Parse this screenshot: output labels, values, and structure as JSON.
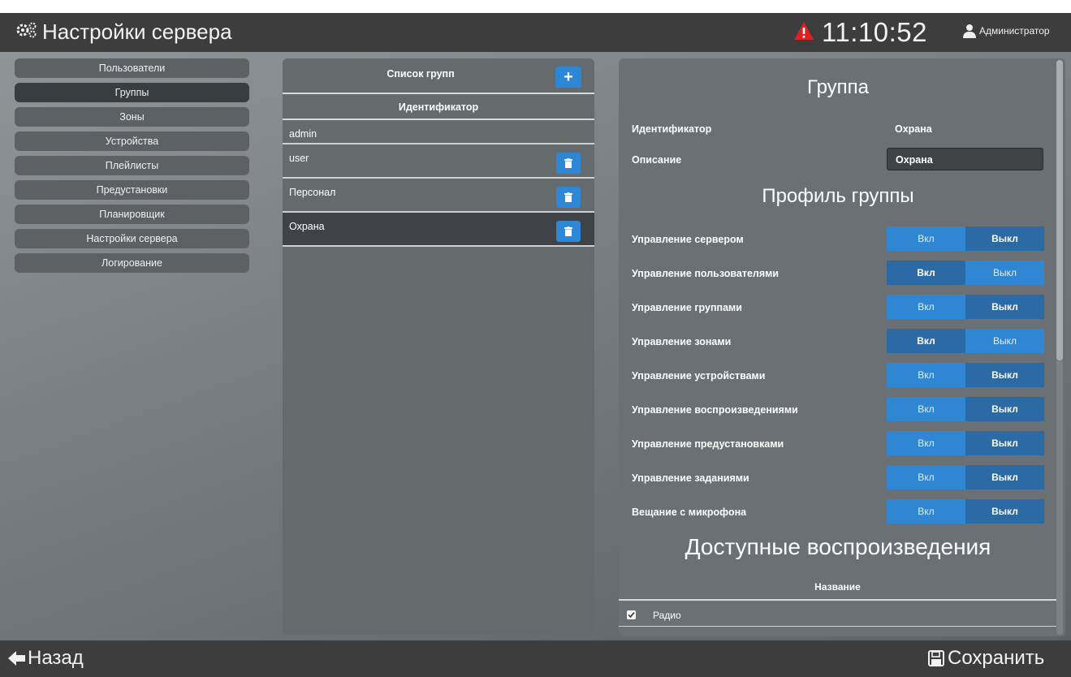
{
  "header": {
    "title": "Настройки сервера",
    "time": "11:10:52",
    "user": "Администратор"
  },
  "sidebar": {
    "items": [
      {
        "label": "Пользователи"
      },
      {
        "label": "Группы"
      },
      {
        "label": "Зоны"
      },
      {
        "label": "Устройства"
      },
      {
        "label": "Плейлисты"
      },
      {
        "label": "Предустановки"
      },
      {
        "label": "Планировщик"
      },
      {
        "label": "Настройки сервера"
      },
      {
        "label": "Логирование"
      }
    ],
    "active_index": 1
  },
  "groups_panel": {
    "title": "Список групп",
    "add_label": "+",
    "column": "Идентификатор",
    "rows": [
      {
        "name": "admin"
      },
      {
        "name": "user"
      },
      {
        "name": "Персонал"
      },
      {
        "name": "Охрана"
      }
    ],
    "selected_index": 3
  },
  "group_detail": {
    "title": "Группа",
    "id_label": "Идентификатор",
    "id_value": "Охрана",
    "desc_label": "Описание",
    "desc_value": "Охрана",
    "profile_title": "Профиль группы",
    "on_label": "Вкл",
    "off_label": "Выкл",
    "permissions": [
      {
        "label": "Управление сервером",
        "state": "off"
      },
      {
        "label": "Управление пользователями",
        "state": "on"
      },
      {
        "label": "Управление группами",
        "state": "off"
      },
      {
        "label": "Управление зонами",
        "state": "on"
      },
      {
        "label": "Управление устройствами",
        "state": "off"
      },
      {
        "label": "Управление воспроизведениями",
        "state": "off"
      },
      {
        "label": "Управление предустановками",
        "state": "off"
      },
      {
        "label": "Управление заданиями",
        "state": "off"
      },
      {
        "label": "Вещание с микрофона",
        "state": "off"
      }
    ],
    "playbacks_title": "Доступные воспроизведения",
    "playbacks_column": "Название",
    "playbacks": [
      {
        "name": "Радио",
        "checked": true
      }
    ]
  },
  "footer": {
    "back_label": "Назад",
    "save_label": "Сохранить"
  },
  "colors": {
    "accent": "#2e86d6",
    "toggle_selected": "#2c6aa6",
    "bar": "#3d3d3d",
    "warning": "#e02020"
  }
}
